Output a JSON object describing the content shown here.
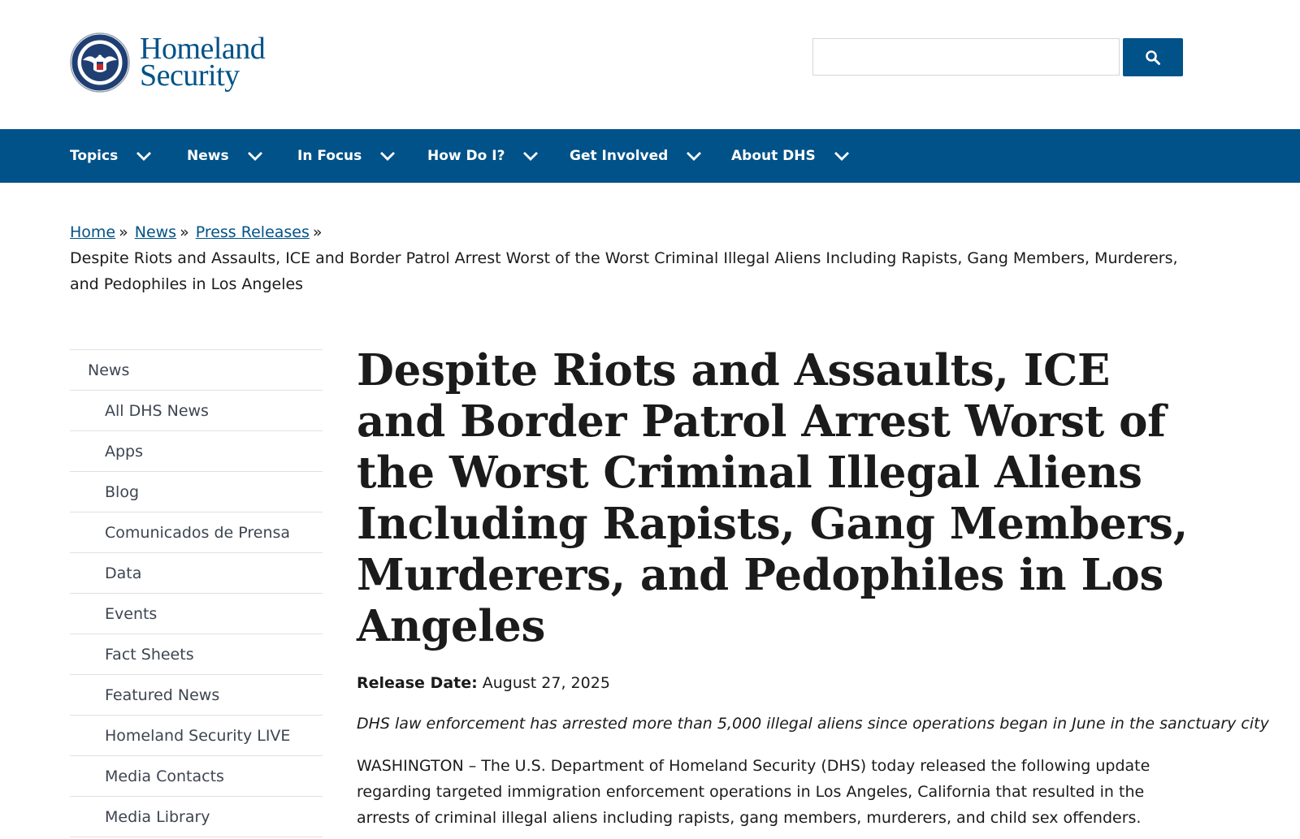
{
  "header": {
    "logo_line1": "Homeland",
    "logo_line2": "Security",
    "search_placeholder": "",
    "search_icon": "search-icon"
  },
  "colors": {
    "brand_blue": "#005288",
    "text": "#1b1b1b",
    "sidebar_text": "#3d4551",
    "divider": "#dfe1e2"
  },
  "nav": {
    "items": [
      {
        "label": "Topics"
      },
      {
        "label": "News"
      },
      {
        "label": "In Focus"
      },
      {
        "label": "How Do I?"
      },
      {
        "label": "Get Involved"
      },
      {
        "label": "About DHS"
      }
    ]
  },
  "breadcrumb": {
    "home": "Home",
    "news": "News",
    "press_releases": "Press Releases",
    "separator": "»",
    "current": "Despite Riots and Assaults, ICE and Border Patrol Arrest Worst of the Worst Criminal Illegal Aliens Including Rapists, Gang Members, Murderers, and Pedophiles in Los Angeles"
  },
  "sidebar": {
    "heading": "News",
    "items": [
      {
        "label": "All DHS News"
      },
      {
        "label": "Apps"
      },
      {
        "label": "Blog"
      },
      {
        "label": "Comunicados de Prensa"
      },
      {
        "label": "Data"
      },
      {
        "label": "Events"
      },
      {
        "label": "Fact Sheets"
      },
      {
        "label": "Featured News"
      },
      {
        "label": "Homeland Security LIVE"
      },
      {
        "label": "Media Contacts"
      },
      {
        "label": "Media Library"
      }
    ]
  },
  "article": {
    "title": "Despite Riots and Assaults, ICE and Border Patrol Arrest Worst of the Worst Criminal Illegal Aliens Including Rapists, Gang Members, Murderers, and Pedophiles in Los Angeles",
    "release_label": "Release Date:",
    "release_date": "August 27, 2025",
    "subtitle": "DHS law enforcement has arrested more than 5,000 illegal aliens since operations began in June in the sanctuary city",
    "body": "WASHINGTON – The U.S. Department of Homeland Security (DHS) today released the following update regarding targeted immigration enforcement operations in Los Angeles, California that resulted in the arrests of criminal illegal aliens including rapists, gang members, murderers, and child sex offenders."
  }
}
